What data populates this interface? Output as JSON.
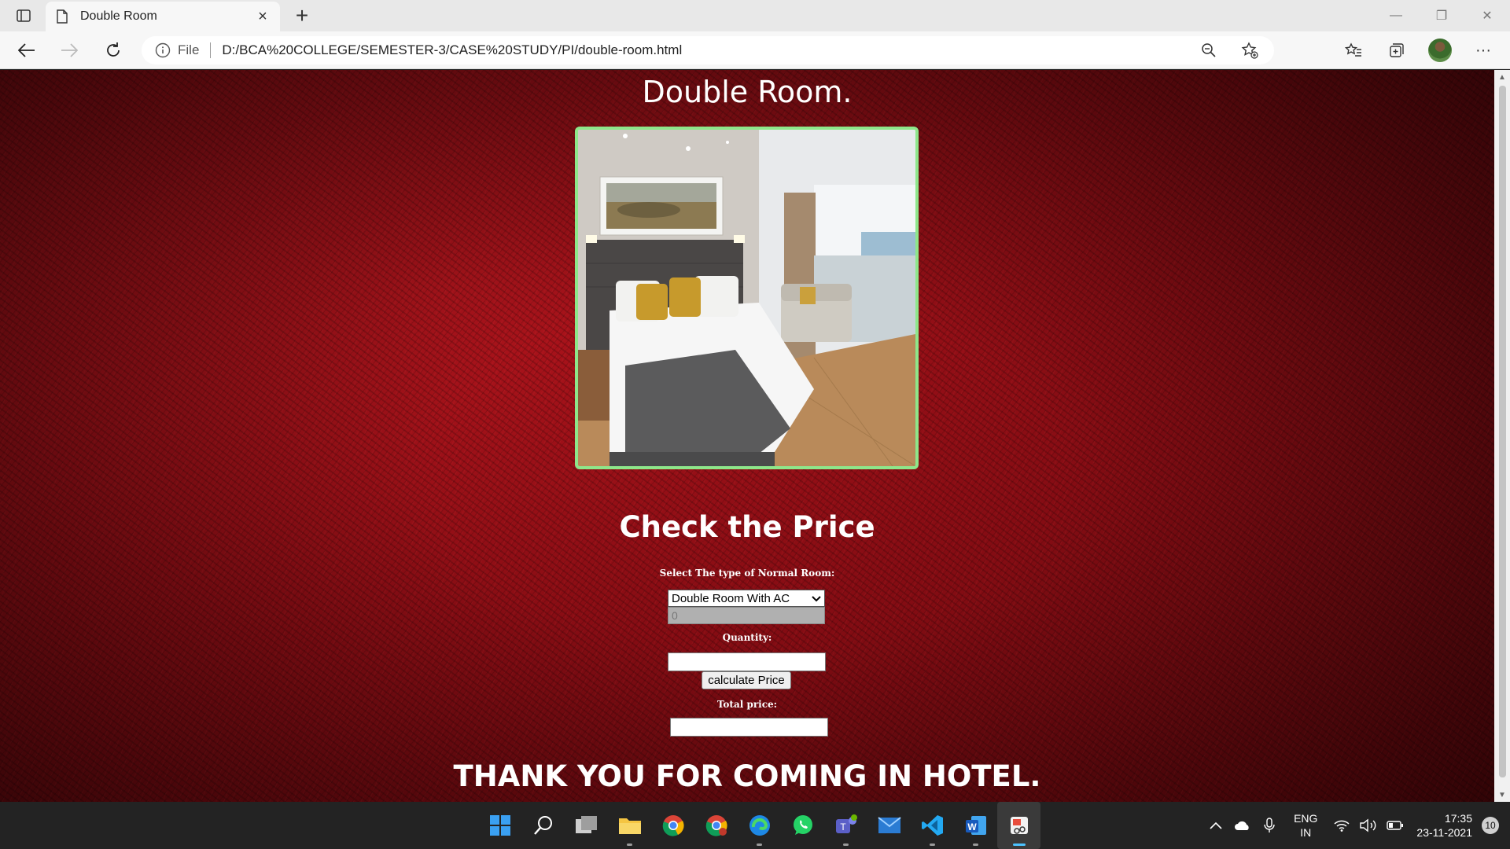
{
  "browser": {
    "tab_title": "Double Room",
    "address_scheme": "File",
    "url": "D:/BCA%20COLLEGE/SEMESTER-3/CASE%20STUDY/PI/double-room.html"
  },
  "page": {
    "heading": "Double Room.",
    "image_icon": "hotel-room-photo",
    "price_section_title": "Check the Price",
    "room_type_label": "Select The type of Normal Room:",
    "room_type_selected": "Double Room With AC",
    "price_value": "0",
    "quantity_label": "Quantity:",
    "quantity_value": "",
    "calculate_button": "calculate Price",
    "total_price_label": "Total price:",
    "total_price_value": "",
    "footer_text": "THANK YOU FOR COMING IN HOTEL."
  },
  "taskbar": {
    "apps": [
      "start",
      "search",
      "task-view",
      "file-explorer",
      "chrome",
      "chrome-profile",
      "edge",
      "whatsapp",
      "teams",
      "mail",
      "vscode",
      "word",
      "snipping-tool"
    ],
    "language_line1": "ENG",
    "language_line2": "IN",
    "time": "17:35",
    "date": "23-11-2021",
    "notification_count": "10"
  },
  "colors": {
    "page_background": "#8a0d14",
    "image_border": "#8ee68a",
    "text": "#ffffff"
  }
}
